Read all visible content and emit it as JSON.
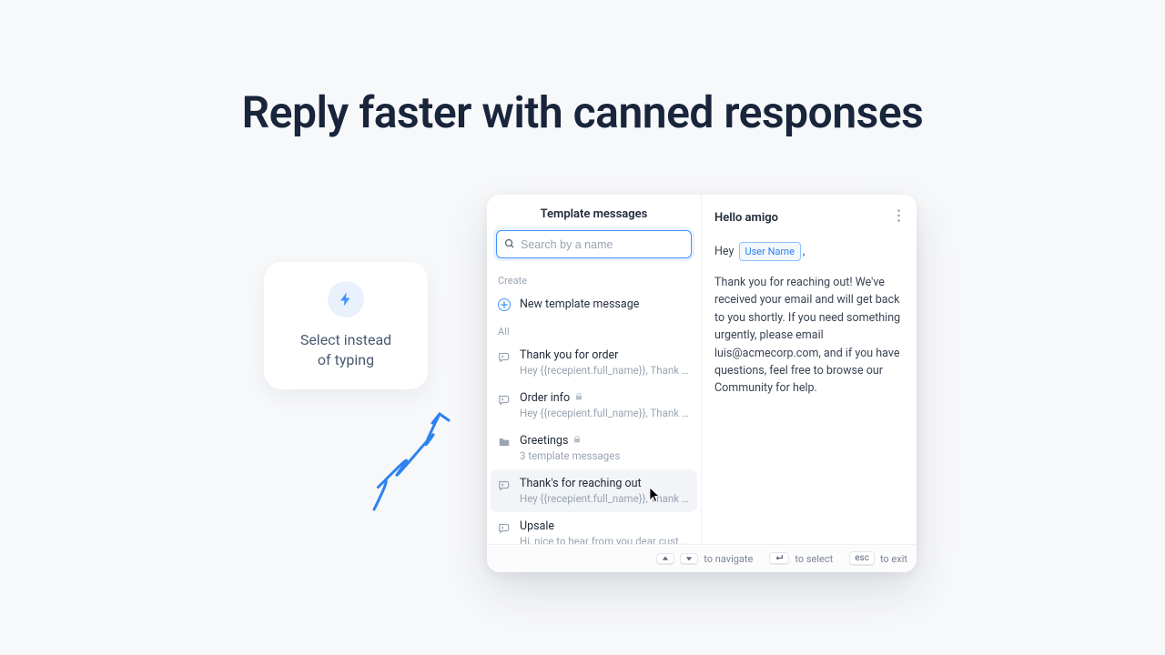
{
  "page": {
    "title": "Reply faster with canned responses"
  },
  "feature": {
    "line1": "Select instead",
    "line2": "of typing"
  },
  "panel": {
    "left_header": "Template messages",
    "search_placeholder": "Search by a name",
    "section_create": "Create",
    "new_template_label": "New template message",
    "section_all": "All",
    "items": [
      {
        "title": "Thank you for order",
        "sub": "Hey {{recepient.full_name}}, Thank you for yo...",
        "locked": false,
        "type": "template"
      },
      {
        "title": "Order info",
        "sub": "Hey {{recepient.full_name}}, Thank you for yo...",
        "locked": true,
        "type": "template"
      },
      {
        "title": "Greetings",
        "sub": "3 template messages",
        "locked": true,
        "type": "folder"
      },
      {
        "title": "Thank's for reaching out",
        "sub": "Hey {{recepient.full_name}}, Thank yo... for yo...",
        "locked": false,
        "type": "template"
      },
      {
        "title": "Upsale",
        "sub": "Hi, nice to hear from you dear customer, how...",
        "locked": false,
        "type": "template"
      }
    ],
    "preview": {
      "title": "Hello amigo",
      "greeting_prefix": "Hey",
      "chip": "User Name",
      "greeting_suffix": ",",
      "body": "Thank you for reaching out! We've received your email and will get back to you shortly. If you need something urgently, please email luis@acmecorp.com, and if you have questions, feel free to browse our Community for help."
    },
    "footer": {
      "navigate": "to navigate",
      "select": "to select",
      "esc_key": "esc",
      "exit": "to exit"
    }
  }
}
